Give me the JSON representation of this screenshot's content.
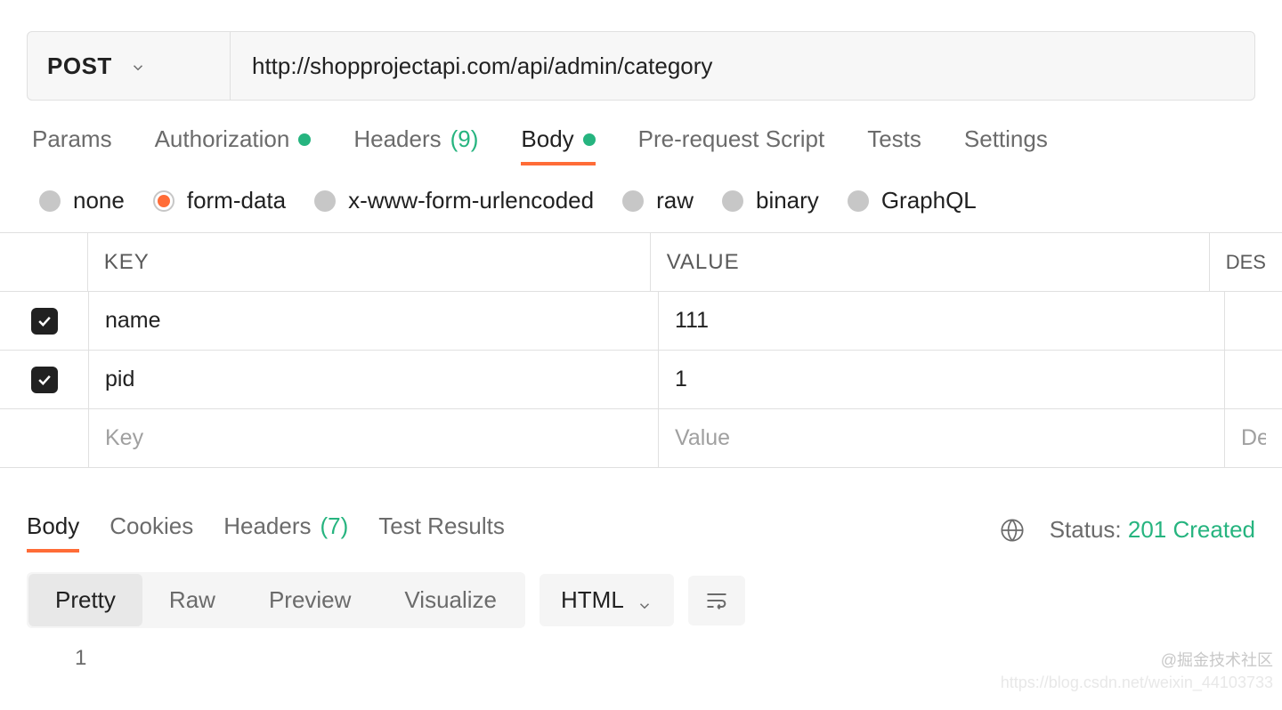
{
  "request": {
    "method": "POST",
    "url": "http://shopprojectapi.com/api/admin/category"
  },
  "tabs": {
    "params": "Params",
    "authorization": "Authorization",
    "headers": "Headers",
    "headers_count": "(9)",
    "body": "Body",
    "prerequest": "Pre-request Script",
    "tests": "Tests",
    "settings": "Settings"
  },
  "body_types": {
    "none": "none",
    "form_data": "form-data",
    "urlencoded": "x-www-form-urlencoded",
    "raw": "raw",
    "binary": "binary",
    "graphql": "GraphQL"
  },
  "table": {
    "headers": {
      "key": "KEY",
      "value": "VALUE",
      "description": "DES"
    },
    "rows": [
      {
        "key": "name",
        "value": "111"
      },
      {
        "key": "pid",
        "value": "1"
      }
    ],
    "placeholders": {
      "key": "Key",
      "value": "Value",
      "description": "Des"
    }
  },
  "response": {
    "tabs": {
      "body": "Body",
      "cookies": "Cookies",
      "headers": "Headers",
      "headers_count": "(7)",
      "test_results": "Test Results"
    },
    "status_label": "Status:",
    "status_value": "201 Created",
    "views": {
      "pretty": "Pretty",
      "raw": "Raw",
      "preview": "Preview",
      "visualize": "Visualize"
    },
    "format": "HTML",
    "line1": "1"
  },
  "watermark": {
    "line1": "@掘金技术社区",
    "line2": "https://blog.csdn.net/weixin_44103733"
  }
}
